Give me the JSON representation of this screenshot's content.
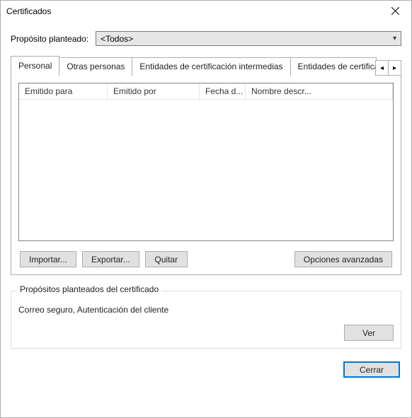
{
  "titlebar": {
    "title": "Certificados"
  },
  "purpose": {
    "label": "Propósito planteado:",
    "selected": "<Todos>"
  },
  "tabs": {
    "items": [
      {
        "label": "Personal",
        "active": true
      },
      {
        "label": "Otras personas",
        "active": false
      },
      {
        "label": "Entidades de certificación intermedias",
        "active": false
      },
      {
        "label": "Entidades de certificac",
        "active": false
      }
    ]
  },
  "list": {
    "columns": {
      "issued_to": "Emitido para",
      "issued_by": "Emitido por",
      "date": "Fecha d...",
      "desc": "Nombre descr..."
    }
  },
  "buttons": {
    "import": "Importar...",
    "export": "Exportar...",
    "remove": "Quitar",
    "advanced": "Opciones avanzadas",
    "view": "Ver",
    "close": "Cerrar"
  },
  "cert_purposes": {
    "group_title": "Propósitos planteados del certificado",
    "text": "Correo seguro, Autenticación del cliente"
  }
}
